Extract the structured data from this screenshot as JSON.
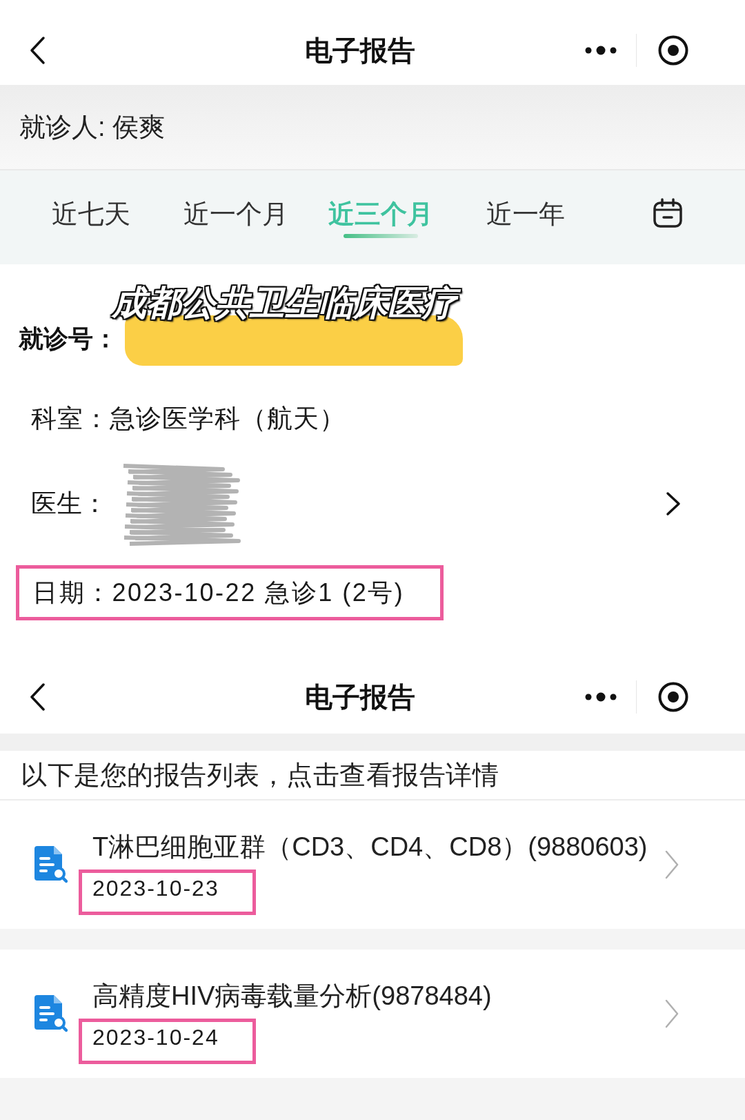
{
  "top_bar": {
    "title": "电子报告"
  },
  "patient": {
    "text": "就诊人: 侯爽"
  },
  "tabs": [
    {
      "label": "近七天",
      "selected": false
    },
    {
      "label": "近一个月",
      "selected": false
    },
    {
      "label": "近三个月",
      "selected": true
    },
    {
      "label": "近一年",
      "selected": false
    }
  ],
  "visit": {
    "overlay_caption": "成都公共卫生临床医疗",
    "number": {
      "label": "就诊号：",
      "redacted": true
    },
    "department": "科室：急诊医学科（航天）",
    "doctor": {
      "label": "医生：",
      "redacted": true
    },
    "date": {
      "text": "日期：2023-10-22 急诊1 (2号)",
      "highlighted": true
    }
  },
  "report_bar": {
    "title": "电子报告"
  },
  "reports": {
    "intro": "以下是您的报告列表，点击查看报告详情",
    "items": [
      {
        "title": "T淋巴细胞亚群（CD3、CD4、CD8）(9880603)",
        "date": "2023-10-23",
        "highlighted": true
      },
      {
        "title": "高精度HIV病毒载量分析(9878484)",
        "date": "2023-10-24",
        "highlighted": true
      }
    ]
  }
}
